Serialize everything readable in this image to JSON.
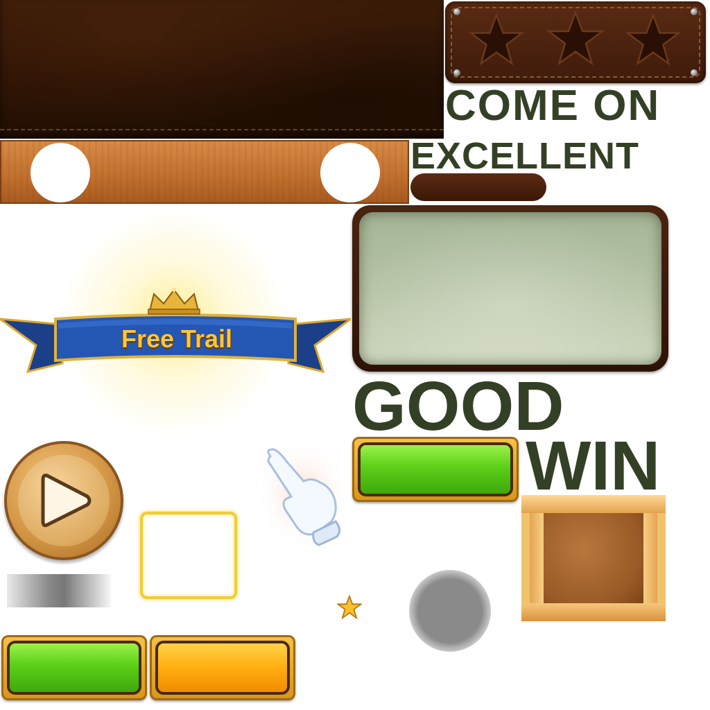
{
  "texts": {
    "come_on": "COME ON",
    "excellent": "EXCELLENT",
    "good": "GOOD",
    "win": "WIN",
    "free_trail": "Free Trail"
  },
  "rating": {
    "stars_total": 3,
    "stars_filled": 0
  },
  "icons": {
    "play": "play-icon",
    "hand": "pointing-hand-icon",
    "star": "star-icon",
    "crown": "crown-icon"
  },
  "colors": {
    "label_text": "#334025",
    "green_button": "#5ccf18",
    "orange_button": "#ffae10",
    "gold_frame": "#f4c24a",
    "leather": "#2c1204",
    "ribbon_blue": "#1f4fa6"
  }
}
